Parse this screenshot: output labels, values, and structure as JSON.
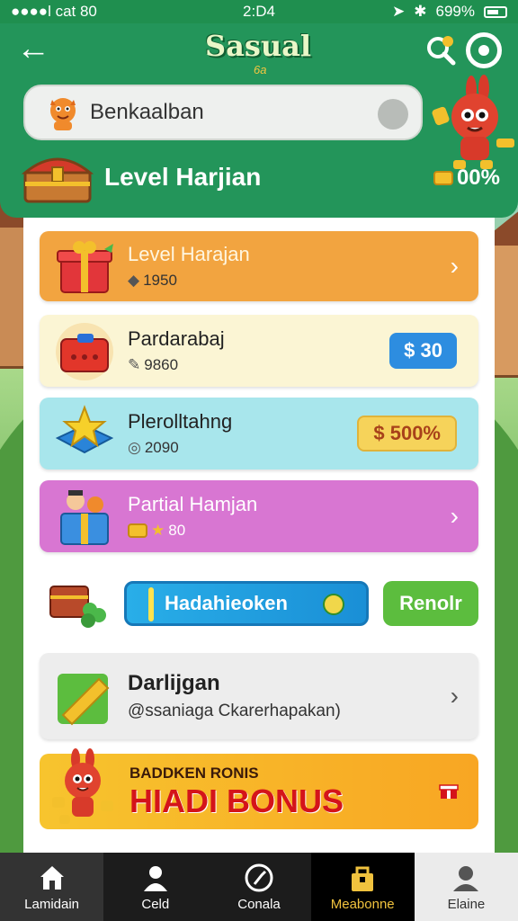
{
  "status_bar": {
    "carrier": "●●●●l cat 80",
    "time": "2:D4",
    "battery": "699%"
  },
  "header": {
    "logo_main": "Sasual",
    "logo_sub": "6a",
    "search_value": "Benkaalban",
    "level_title": "Level Harjian",
    "level_percent": "00%"
  },
  "cards": [
    {
      "title": "Level Harajan",
      "sub": "1950",
      "bg": "#f2a440"
    },
    {
      "title": "Pardarabaj",
      "sub": "9860",
      "price": "$ 30",
      "bg": "#fbf5d4"
    },
    {
      "title": "Plerolltahng",
      "sub": "2090",
      "price": "$ 500%",
      "bg": "#a8e6ec"
    },
    {
      "title": "Partial Hamjan",
      "sub": "80",
      "bg": "#d876d2"
    }
  ],
  "promo": {
    "input_value": "Hadahieoken",
    "button_label": "Renolr"
  },
  "info_card": {
    "title": "Darlijgan",
    "sub": "@ssaniaga Ckarerhapakan)"
  },
  "bonus": {
    "small": "BADDKEN RONIS",
    "big": "HIADI BONUS"
  },
  "nav": [
    {
      "label": "Lamidain",
      "icon": "home-icon"
    },
    {
      "label": "Celd",
      "icon": "user-icon"
    },
    {
      "label": "Conala",
      "icon": "compass-icon"
    },
    {
      "label": "Meabonne",
      "icon": "shop-bag-icon"
    },
    {
      "label": "Elaine",
      "icon": "profile-icon"
    }
  ],
  "colors": {
    "header_green": "#23955a",
    "accent_yellow": "#f0c23e",
    "bonus_red": "#d4141a"
  }
}
